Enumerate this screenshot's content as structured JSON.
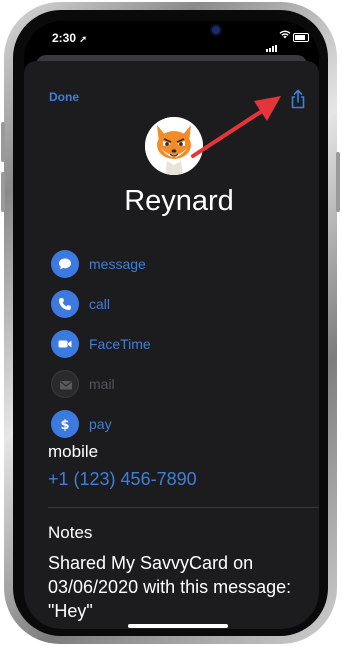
{
  "status": {
    "time": "2:30",
    "location_icon": "location-arrow-icon"
  },
  "header": {
    "done_label": "Done",
    "share_icon": "share-icon"
  },
  "contact": {
    "name": "Reynard",
    "avatar_icon": "fox-avatar-icon"
  },
  "actions": [
    {
      "label": "message",
      "icon": "message-icon",
      "enabled": true
    },
    {
      "label": "call",
      "icon": "phone-icon",
      "enabled": true
    },
    {
      "label": "FaceTime",
      "icon": "video-icon",
      "enabled": true
    },
    {
      "label": "mail",
      "icon": "mail-icon",
      "enabled": false
    },
    {
      "label": "pay",
      "icon": "dollar-icon",
      "enabled": true
    }
  ],
  "phone_field": {
    "label": "mobile",
    "value": "+1 (123) 456-7890"
  },
  "notes": {
    "label": "Notes",
    "text": "Shared My SavvyCard on 03/06/2020 with this message: \"Hey\""
  },
  "colors": {
    "accent": "#3f7fd9",
    "sheet_bg": "#1c1c1e",
    "annotation_arrow": "#e5353a"
  }
}
